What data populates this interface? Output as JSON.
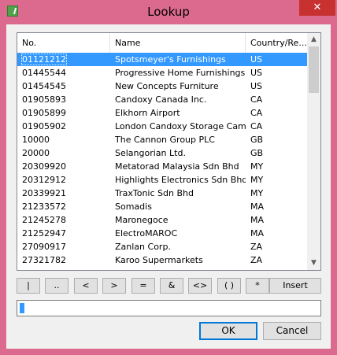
{
  "window": {
    "title": "Lookup",
    "minimize_symbol": "—",
    "maximize_symbol": "□",
    "close_symbol": "✕"
  },
  "columns": [
    "No.",
    "Name",
    "Country/Re..."
  ],
  "rows": [
    {
      "no": "01121212",
      "name": "Spotsmeyer's Furnishings",
      "country": "US",
      "selected": true
    },
    {
      "no": "01445544",
      "name": "Progressive Home Furnishings",
      "country": "US"
    },
    {
      "no": "01454545",
      "name": "New Concepts Furniture",
      "country": "US"
    },
    {
      "no": "01905893",
      "name": "Candoxy Canada Inc.",
      "country": "CA"
    },
    {
      "no": "01905899",
      "name": "Elkhorn Airport",
      "country": "CA"
    },
    {
      "no": "01905902",
      "name": "London Candoxy Storage Campus",
      "country": "CA"
    },
    {
      "no": "10000",
      "name": "The Cannon Group PLC",
      "country": "GB"
    },
    {
      "no": "20000",
      "name": "Selangorian Ltd.",
      "country": "GB"
    },
    {
      "no": "20309920",
      "name": "Metatorad Malaysia Sdn Bhd",
      "country": "MY"
    },
    {
      "no": "20312912",
      "name": "Highlights Electronics Sdn Bhd",
      "country": "MY"
    },
    {
      "no": "20339921",
      "name": "TraxTonic Sdn Bhd",
      "country": "MY"
    },
    {
      "no": "21233572",
      "name": "Somadis",
      "country": "MA"
    },
    {
      "no": "21245278",
      "name": "Maronegoce",
      "country": "MA"
    },
    {
      "no": "21252947",
      "name": "ElectroMAROC",
      "country": "MA"
    },
    {
      "no": "27090917",
      "name": "Zanlan Corp.",
      "country": "ZA"
    },
    {
      "no": "27321782",
      "name": "Karoo Supermarkets",
      "country": "ZA"
    }
  ],
  "scrollbar": {
    "up_arrow": "▲",
    "down_arrow": "▼"
  },
  "operators": [
    "|",
    "..",
    "<",
    ">",
    "=",
    "&",
    "<>",
    "( )",
    "*",
    "Insert"
  ],
  "expression": {
    "value": ""
  },
  "buttons": {
    "ok": "OK",
    "cancel": "Cancel"
  }
}
